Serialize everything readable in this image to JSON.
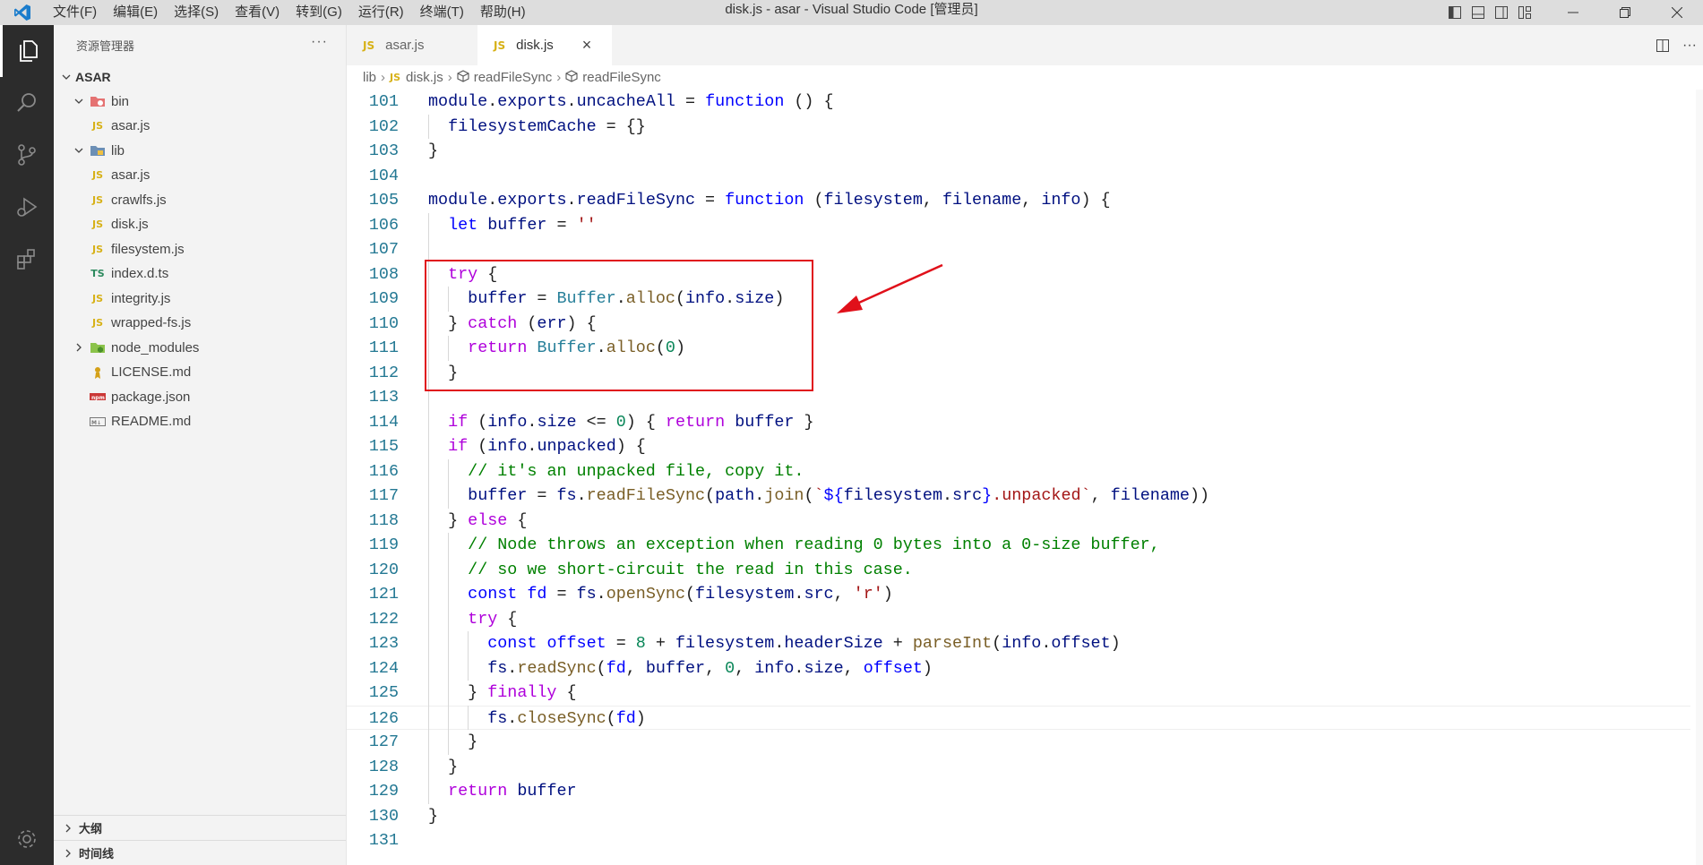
{
  "titlebar": {
    "menus": [
      "文件(F)",
      "编辑(E)",
      "选择(S)",
      "查看(V)",
      "转到(G)",
      "运行(R)",
      "终端(T)",
      "帮助(H)"
    ],
    "window_title": "disk.js - asar - Visual Studio Code [管理员]"
  },
  "sidebar": {
    "header": "资源管理器",
    "more": "···",
    "root": "ASAR",
    "tree": [
      {
        "label": "bin",
        "type": "folder",
        "expanded": true,
        "depth": 1
      },
      {
        "label": "asar.js",
        "type": "js",
        "depth": 2
      },
      {
        "label": "lib",
        "type": "folder",
        "expanded": true,
        "depth": 1
      },
      {
        "label": "asar.js",
        "type": "js",
        "depth": 2
      },
      {
        "label": "crawlfs.js",
        "type": "js",
        "depth": 2
      },
      {
        "label": "disk.js",
        "type": "js",
        "depth": 2
      },
      {
        "label": "filesystem.js",
        "type": "js",
        "depth": 2
      },
      {
        "label": "index.d.ts",
        "type": "ts",
        "depth": 2
      },
      {
        "label": "integrity.js",
        "type": "js",
        "depth": 2
      },
      {
        "label": "wrapped-fs.js",
        "type": "js",
        "depth": 2
      },
      {
        "label": "node_modules",
        "type": "folder",
        "expanded": false,
        "depth": 1
      },
      {
        "label": "LICENSE.md",
        "type": "license",
        "depth": 1
      },
      {
        "label": "package.json",
        "type": "npm",
        "depth": 1
      },
      {
        "label": "README.md",
        "type": "md",
        "depth": 1
      }
    ],
    "panels": [
      "大纲",
      "时间线"
    ]
  },
  "tabs": [
    {
      "label": "asar.js",
      "badge": "JS",
      "active": false
    },
    {
      "label": "disk.js",
      "badge": "JS",
      "active": true,
      "close": "×"
    }
  ],
  "breadcrumbs": [
    "lib",
    "disk.js",
    "readFileSync",
    "readFileSync"
  ],
  "breadcrumb_badge": "JS",
  "icons": {
    "ts_badge": "TS",
    "js_badge": "JS"
  },
  "editor": {
    "current_line": 126,
    "lines": [
      {
        "n": "101",
        "code": [
          [
            "v",
            "module"
          ],
          [
            "p",
            "."
          ],
          [
            "v",
            "exports"
          ],
          [
            "p",
            "."
          ],
          [
            "v",
            "uncacheAll"
          ],
          [
            "p",
            " = "
          ],
          [
            "b",
            "function"
          ],
          [
            "p",
            " () {"
          ]
        ]
      },
      {
        "n": "102",
        "code": [
          [
            "p",
            "  "
          ],
          [
            "v",
            "filesystemCache"
          ],
          [
            "p",
            " = {}"
          ]
        ]
      },
      {
        "n": "103",
        "code": [
          [
            "p",
            "}"
          ]
        ]
      },
      {
        "n": "104",
        "code": []
      },
      {
        "n": "105",
        "code": [
          [
            "v",
            "module"
          ],
          [
            "p",
            "."
          ],
          [
            "v",
            "exports"
          ],
          [
            "p",
            "."
          ],
          [
            "v",
            "readFileSync"
          ],
          [
            "p",
            " = "
          ],
          [
            "b",
            "function"
          ],
          [
            "p",
            " ("
          ],
          [
            "v",
            "filesystem"
          ],
          [
            "p",
            ", "
          ],
          [
            "v",
            "filename"
          ],
          [
            "p",
            ", "
          ],
          [
            "v",
            "info"
          ],
          [
            "p",
            ") {"
          ]
        ]
      },
      {
        "n": "106",
        "code": [
          [
            "p",
            "  "
          ],
          [
            "b",
            "let"
          ],
          [
            "p",
            " "
          ],
          [
            "v",
            "buffer"
          ],
          [
            "p",
            " = "
          ],
          [
            "s",
            "''"
          ]
        ]
      },
      {
        "n": "107",
        "code": []
      },
      {
        "n": "108",
        "code": [
          [
            "p",
            "  "
          ],
          [
            "k",
            "try"
          ],
          [
            "p",
            " {"
          ]
        ]
      },
      {
        "n": "109",
        "code": [
          [
            "p",
            "    "
          ],
          [
            "v",
            "buffer"
          ],
          [
            "p",
            " = "
          ],
          [
            "t",
            "Buffer"
          ],
          [
            "p",
            "."
          ],
          [
            "f",
            "alloc"
          ],
          [
            "p",
            "("
          ],
          [
            "v",
            "info"
          ],
          [
            "p",
            "."
          ],
          [
            "v",
            "size"
          ],
          [
            "p",
            ")"
          ]
        ]
      },
      {
        "n": "110",
        "code": [
          [
            "p",
            "  } "
          ],
          [
            "k",
            "catch"
          ],
          [
            "p",
            " ("
          ],
          [
            "v",
            "err"
          ],
          [
            "p",
            ") {"
          ]
        ]
      },
      {
        "n": "111",
        "code": [
          [
            "p",
            "    "
          ],
          [
            "k",
            "return"
          ],
          [
            "p",
            " "
          ],
          [
            "t",
            "Buffer"
          ],
          [
            "p",
            "."
          ],
          [
            "f",
            "alloc"
          ],
          [
            "p",
            "("
          ],
          [
            "n",
            "0"
          ],
          [
            "p",
            ")"
          ]
        ]
      },
      {
        "n": "112",
        "code": [
          [
            "p",
            "  }"
          ]
        ]
      },
      {
        "n": "113",
        "code": []
      },
      {
        "n": "114",
        "code": [
          [
            "p",
            "  "
          ],
          [
            "k",
            "if"
          ],
          [
            "p",
            " ("
          ],
          [
            "v",
            "info"
          ],
          [
            "p",
            "."
          ],
          [
            "v",
            "size"
          ],
          [
            "p",
            " <= "
          ],
          [
            "n",
            "0"
          ],
          [
            "p",
            ") { "
          ],
          [
            "k",
            "return"
          ],
          [
            "p",
            " "
          ],
          [
            "v",
            "buffer"
          ],
          [
            "p",
            " }"
          ]
        ]
      },
      {
        "n": "115",
        "code": [
          [
            "p",
            "  "
          ],
          [
            "k",
            "if"
          ],
          [
            "p",
            " ("
          ],
          [
            "v",
            "info"
          ],
          [
            "p",
            "."
          ],
          [
            "v",
            "unpacked"
          ],
          [
            "p",
            ") {"
          ]
        ]
      },
      {
        "n": "116",
        "code": [
          [
            "p",
            "    "
          ],
          [
            "c",
            "// it's an unpacked file, copy it."
          ]
        ]
      },
      {
        "n": "117",
        "code": [
          [
            "p",
            "    "
          ],
          [
            "v",
            "buffer"
          ],
          [
            "p",
            " = "
          ],
          [
            "v",
            "fs"
          ],
          [
            "p",
            "."
          ],
          [
            "f",
            "readFileSync"
          ],
          [
            "p",
            "("
          ],
          [
            "v",
            "path"
          ],
          [
            "p",
            "."
          ],
          [
            "f",
            "join"
          ],
          [
            "p",
            "("
          ],
          [
            "s",
            "`"
          ],
          [
            "b",
            "${"
          ],
          [
            "v",
            "filesystem"
          ],
          [
            "p",
            "."
          ],
          [
            "v",
            "src"
          ],
          [
            "b",
            "}"
          ],
          [
            "s",
            ".unpacked`"
          ],
          [
            "p",
            ", "
          ],
          [
            "v",
            "filename"
          ],
          [
            "p",
            "))"
          ]
        ]
      },
      {
        "n": "118",
        "code": [
          [
            "p",
            "  } "
          ],
          [
            "k",
            "else"
          ],
          [
            "p",
            " {"
          ]
        ]
      },
      {
        "n": "119",
        "code": [
          [
            "p",
            "    "
          ],
          [
            "c",
            "// Node throws an exception when reading 0 bytes into a 0-size buffer,"
          ]
        ]
      },
      {
        "n": "120",
        "code": [
          [
            "p",
            "    "
          ],
          [
            "c",
            "// so we short-circuit the read in this case."
          ]
        ]
      },
      {
        "n": "121",
        "code": [
          [
            "p",
            "    "
          ],
          [
            "b",
            "const"
          ],
          [
            "p",
            " "
          ],
          [
            "b",
            "fd"
          ],
          [
            "p",
            " = "
          ],
          [
            "v",
            "fs"
          ],
          [
            "p",
            "."
          ],
          [
            "f",
            "openSync"
          ],
          [
            "p",
            "("
          ],
          [
            "v",
            "filesystem"
          ],
          [
            "p",
            "."
          ],
          [
            "v",
            "src"
          ],
          [
            "p",
            ", "
          ],
          [
            "s",
            "'r'"
          ],
          [
            "p",
            ")"
          ]
        ]
      },
      {
        "n": "122",
        "code": [
          [
            "p",
            "    "
          ],
          [
            "k",
            "try"
          ],
          [
            "p",
            " {"
          ]
        ]
      },
      {
        "n": "123",
        "code": [
          [
            "p",
            "      "
          ],
          [
            "b",
            "const"
          ],
          [
            "p",
            " "
          ],
          [
            "b",
            "offset"
          ],
          [
            "p",
            " = "
          ],
          [
            "n",
            "8"
          ],
          [
            "p",
            " + "
          ],
          [
            "v",
            "filesystem"
          ],
          [
            "p",
            "."
          ],
          [
            "v",
            "headerSize"
          ],
          [
            "p",
            " + "
          ],
          [
            "f",
            "parseInt"
          ],
          [
            "p",
            "("
          ],
          [
            "v",
            "info"
          ],
          [
            "p",
            "."
          ],
          [
            "v",
            "offset"
          ],
          [
            "p",
            ")"
          ]
        ]
      },
      {
        "n": "124",
        "code": [
          [
            "p",
            "      "
          ],
          [
            "v",
            "fs"
          ],
          [
            "p",
            "."
          ],
          [
            "f",
            "readSync"
          ],
          [
            "p",
            "("
          ],
          [
            "b",
            "fd"
          ],
          [
            "p",
            ", "
          ],
          [
            "v",
            "buffer"
          ],
          [
            "p",
            ", "
          ],
          [
            "n",
            "0"
          ],
          [
            "p",
            ", "
          ],
          [
            "v",
            "info"
          ],
          [
            "p",
            "."
          ],
          [
            "v",
            "size"
          ],
          [
            "p",
            ", "
          ],
          [
            "b",
            "offset"
          ],
          [
            "p",
            ")"
          ]
        ]
      },
      {
        "n": "125",
        "code": [
          [
            "p",
            "    } "
          ],
          [
            "k",
            "finally"
          ],
          [
            "p",
            " {"
          ]
        ]
      },
      {
        "n": "126",
        "code": [
          [
            "p",
            "      "
          ],
          [
            "v",
            "fs"
          ],
          [
            "p",
            "."
          ],
          [
            "f",
            "closeSync"
          ],
          [
            "p",
            "("
          ],
          [
            "b",
            "fd"
          ],
          [
            "p",
            ")"
          ]
        ]
      },
      {
        "n": "127",
        "code": [
          [
            "p",
            "    }"
          ]
        ]
      },
      {
        "n": "128",
        "code": [
          [
            "p",
            "  }"
          ]
        ]
      },
      {
        "n": "129",
        "code": [
          [
            "p",
            "  "
          ],
          [
            "k",
            "return"
          ],
          [
            "p",
            " "
          ],
          [
            "v",
            "buffer"
          ]
        ]
      },
      {
        "n": "130",
        "code": [
          [
            "p",
            "}"
          ]
        ]
      },
      {
        "n": "131",
        "code": []
      }
    ]
  },
  "colors": {
    "annotation": "#e0101a",
    "activity_bar": "#2c2c2c",
    "sidebar_bg": "#f3f3f3",
    "titlebar_bg": "#dddddd"
  }
}
